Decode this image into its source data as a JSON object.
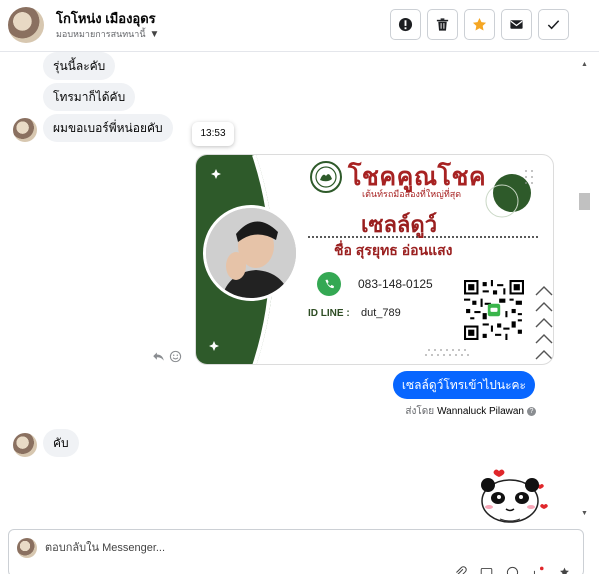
{
  "header": {
    "name": "โกโหน่ง เมืองอุดร",
    "assignee": "มอบหมายการสนทนานี้",
    "actions": [
      {
        "icon": "alert-icon",
        "label": "Mark as spam"
      },
      {
        "icon": "trash-icon",
        "label": "Delete"
      },
      {
        "icon": "star-icon",
        "label": "Follow up"
      },
      {
        "icon": "envelope-icon",
        "label": "Mark as unread"
      },
      {
        "icon": "check-icon",
        "label": "Mark as done"
      }
    ]
  },
  "messages": {
    "incoming_1": "รุ่นนี้ละคับ",
    "incoming_2": "โทรมาก็ได้คับ",
    "incoming_3": "ผมขอเบอร์พี่หน่อยคับ",
    "tooltip_time": "13:53",
    "card": {
      "brand": "โชคคูณโชค",
      "slogan": "เต้นท์รถมือสองที่ใหญ่ที่สุด",
      "nickname": "เซลล์ดูว์",
      "full_name": "ชื่อ สุรยุทธ อ่อนแสง",
      "phone": "083-148-0125",
      "line_label": "ID LINE :",
      "line_id": "dut_789"
    },
    "outgoing_1": "เซลล์ดูว์โทรเข้าไปนะคะ",
    "sent_by_prefix": "ส่งโดย",
    "sent_by_name": "Wannaluck Pilawan",
    "incoming_4": "คับ"
  },
  "composer": {
    "placeholder": "ตอบกลับใน Messenger...",
    "value": ""
  },
  "colors": {
    "accent": "#0866ff",
    "card_green": "#2e5a2a",
    "card_red": "#9a1f1f",
    "star": "#f5a623"
  }
}
